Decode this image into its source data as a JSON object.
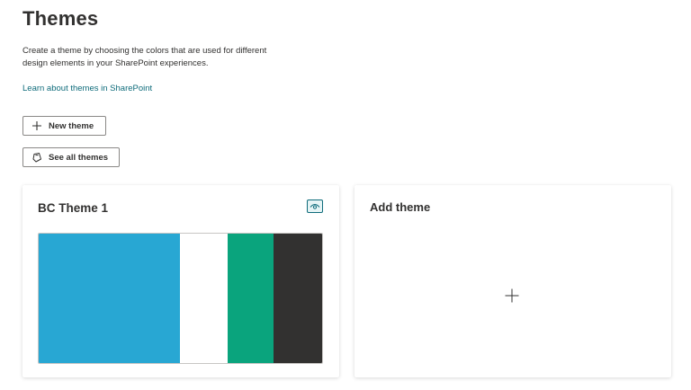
{
  "page": {
    "title": "Themes",
    "description": "Create a theme by choosing the colors that are used for different design elements in your SharePoint experiences.",
    "learn_link": "Learn about themes in SharePoint"
  },
  "buttons": {
    "new_theme": {
      "label": "New theme",
      "icon": "plus-icon"
    },
    "see_all_themes": {
      "label": "See all themes",
      "icon": "paint-bucket-icon"
    }
  },
  "theme_card": {
    "title": "BC Theme 1",
    "preview_icon": "eye-icon",
    "swatches": [
      "#28a7d3",
      "#ffffff",
      "#0aa47d",
      "#323130"
    ]
  },
  "add_card": {
    "title": "Add theme",
    "icon": "plus-icon"
  },
  "colors": {
    "link": "#0f6c7b",
    "text": "#323130"
  }
}
